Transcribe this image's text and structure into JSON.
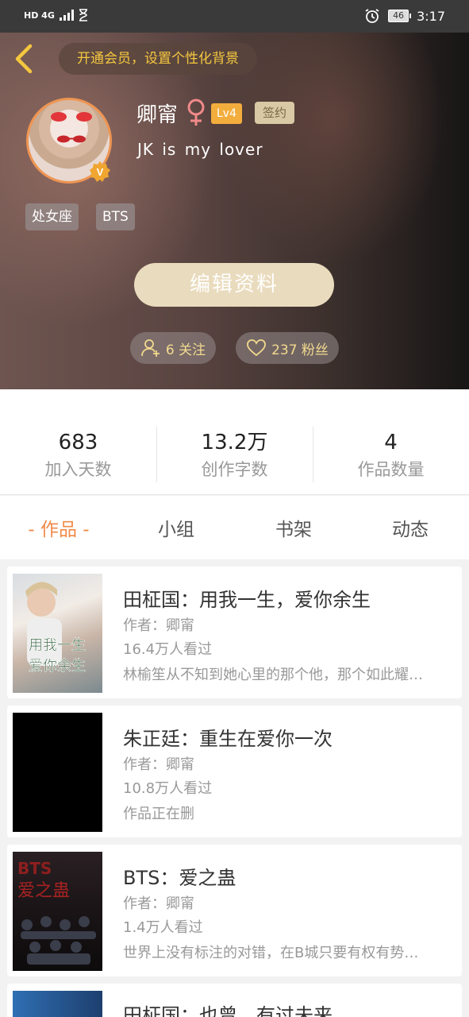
{
  "status_bar": {
    "network": "HD 4G",
    "battery": "46",
    "time": "3:17"
  },
  "header": {
    "vip_banner": "开通会员，设置个性化背景",
    "nickname": "卿甯",
    "gender_symbol": "♀",
    "level": "Lv4",
    "sign_badge": "签约",
    "signature": "JK is my lover",
    "verified_badge": "V",
    "tags": [
      "处女座",
      "BTS"
    ],
    "edit_button": "编辑资料",
    "following": "6 关注",
    "followers": "237 粉丝"
  },
  "stats": [
    {
      "value": "683",
      "label": "加入天数"
    },
    {
      "value": "13.2万",
      "label": "创作字数"
    },
    {
      "value": "4",
      "label": "作品数量"
    }
  ],
  "tabs": [
    {
      "label": "- 作品 -",
      "active": true
    },
    {
      "label": "小组",
      "active": false
    },
    {
      "label": "书架",
      "active": false
    },
    {
      "label": "动态",
      "active": false
    }
  ],
  "books": [
    {
      "title": "田柾国：用我一生，爱你余生",
      "author": "作者：卿甯",
      "views": "16.4万人看过",
      "desc": "林榆笙从不知到她心里的那个他，那个如此耀…",
      "cover_text": "用我一生 爱你余生"
    },
    {
      "title": "朱正廷：重生在爱你一次",
      "author": "作者：卿甯",
      "views": "10.8万人看过",
      "desc": "作品正在删"
    },
    {
      "title": "BTS：爱之蛊",
      "author": "作者：卿甯",
      "views": "1.4万人看过",
      "desc": "世界上没有标注的对错，在B城只要有权有势…",
      "cover_text": "BTS 爱之蛊"
    },
    {
      "title": "田柾国：也曾，有过未来"
    }
  ],
  "colors": {
    "accent": "#f08a47",
    "gold": "#f5c73f",
    "edit_button": "#e9dbbd"
  }
}
